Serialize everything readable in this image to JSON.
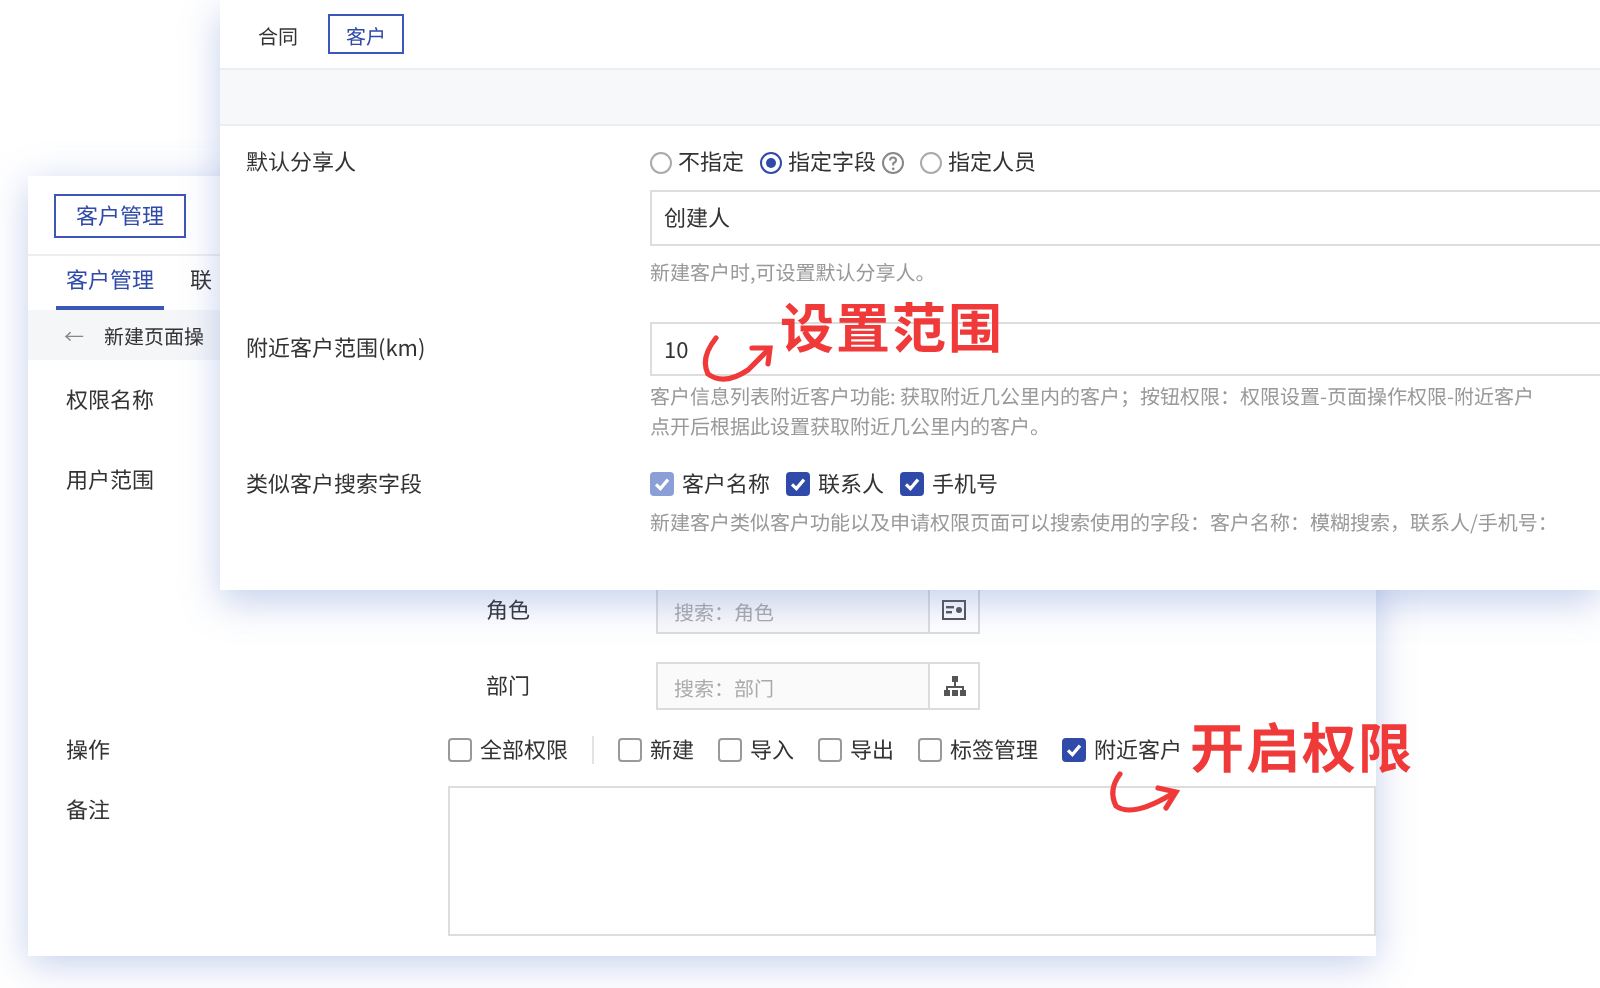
{
  "back_window": {
    "top_tabs": [
      {
        "label": "客户管理",
        "selected": true
      }
    ],
    "sub_tabs": [
      {
        "label": "客户管理",
        "selected": true
      },
      {
        "label": "联",
        "selected": false
      }
    ],
    "breadcrumb": {
      "back": "←",
      "title": "新建页面操"
    },
    "rows": [
      {
        "kind": "label",
        "label": "权限名称"
      },
      {
        "kind": "label",
        "label": "用户范围"
      },
      {
        "kind": "search",
        "label": "角色",
        "placeholder": "搜索：角色"
      },
      {
        "kind": "search",
        "label": "部门",
        "placeholder": "搜索：部门"
      },
      {
        "kind": "checks",
        "label": "操作",
        "options": [
          {
            "label": "全部权限",
            "checked": false,
            "kind": "all"
          },
          {
            "label": "新建",
            "checked": false,
            "kind": "item"
          },
          {
            "label": "导入",
            "checked": false,
            "kind": "item"
          },
          {
            "label": "导出",
            "checked": false,
            "kind": "item"
          },
          {
            "label": "标签管理",
            "checked": false,
            "kind": "item"
          },
          {
            "label": "附近客户",
            "checked": true,
            "kind": "item"
          }
        ]
      },
      {
        "kind": "textarea",
        "label": "备注"
      }
    ]
  },
  "front_window": {
    "tabs": [
      {
        "label": "合同",
        "selected": false
      },
      {
        "label": "客户",
        "selected": true
      }
    ],
    "sharer": {
      "label": "默认分享人",
      "options": [
        {
          "label": "不指定",
          "selected": false,
          "help": false
        },
        {
          "label": "指定字段",
          "selected": true,
          "help": true
        },
        {
          "label": "指定人员",
          "selected": false,
          "help": false
        }
      ],
      "value": "创建人",
      "hint": "新建客户时,可设置默认分享人。"
    },
    "range": {
      "label": "附近客户范围(km)",
      "value": "10",
      "hint": [
        "客户信息列表附近客户功能: 获取附近几公里内的客户；按钮权限：权限设置-页面操作权限-附近客户",
        "点开后根据此设置获取附近几公里内的客户。"
      ]
    },
    "similar": {
      "label": "类似客户搜索字段",
      "options": [
        {
          "label": "客户名称",
          "checked": true,
          "disabled": true
        },
        {
          "label": "联系人",
          "checked": true,
          "disabled": false
        },
        {
          "label": "手机号",
          "checked": true,
          "disabled": false
        }
      ],
      "hint": "新建客户类似客户功能以及申请权限页面可以搜索使用的字段：客户名称：模糊搜索，联系人/手机号："
    }
  },
  "annotations": [
    {
      "text": "设置范围"
    },
    {
      "text": "开启权限"
    }
  ]
}
